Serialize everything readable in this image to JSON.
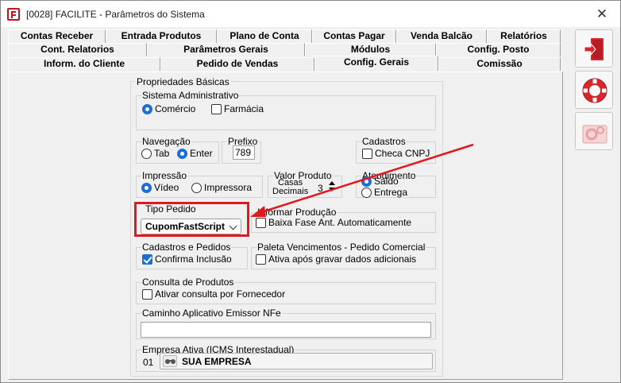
{
  "window": {
    "title": "[0028] FACILITE - Parâmetros do Sistema",
    "close_glyph": "✕"
  },
  "tabs": {
    "row1": [
      "Contas Receber",
      "Entrada Produtos",
      "Plano de Conta",
      "Contas Pagar",
      "Venda Balcão",
      "Relatórios"
    ],
    "row2": [
      "Cont. Relatorios",
      "Parâmetros Gerais",
      "Módulos",
      "Config. Posto"
    ],
    "row3": [
      "Inform. do Cliente",
      "Pedido de Vendas",
      "Config. Gerais",
      "Comissão"
    ],
    "active": "Config. Gerais"
  },
  "propriedades": {
    "title": "Propriedades Básicas",
    "sistema_admin": {
      "title": "Sistema Administrativo",
      "comercio": "Comércio",
      "comercio_selected": true,
      "farmacia": "Farmácia",
      "farmacia_checked": false
    },
    "navegacao": {
      "title": "Navegação",
      "tab": "Tab",
      "enter": "Enter",
      "selected": "Enter"
    },
    "prefixo": {
      "title": "Prefixo",
      "value": "789"
    },
    "cadastros": {
      "title": "Cadastros",
      "checa_cnpj": "Checa CNPJ",
      "checked": false
    },
    "impressao": {
      "title": "Impressão",
      "video": "Vídeo",
      "impressora": "Impressora",
      "selected": "Vídeo"
    },
    "valor_produto": {
      "title": "Valor Produto",
      "casas": "Casas",
      "decimais": "Decimais",
      "value": "3"
    },
    "atendimento": {
      "title": "Atendimento",
      "saldo": "Saldo",
      "entrega": "Entrega",
      "selected": "Saldo"
    },
    "tipo_pedido": {
      "title": "Tipo Pedido",
      "value": "CupomFastScript"
    },
    "informar_producao": {
      "title": "Informar Produção",
      "baixa_fase": "Baixa Fase Ant. Automaticamente",
      "checked": false
    },
    "cadastros_pedidos": {
      "title": "Cadastros e Pedidos",
      "confirma_inclusao": "Confirma Inclusão",
      "checked": true
    },
    "paleta": {
      "title": "Paleta Vencimentos - Pedido Comercial",
      "ativa": "Ativa após gravar dados adicionais",
      "checked": false
    },
    "consulta_produtos": {
      "title": "Consulta de Produtos",
      "ativar": "Ativar consulta por Fornecedor",
      "checked": false
    },
    "caminho_nfe": {
      "title": "Caminho Aplicativo Emissor NFe",
      "value": ""
    },
    "empresa_ativa": {
      "title": "Empresa Ativa (ICMS Interestadual)",
      "code": "01",
      "name": "SUA EMPRESA"
    }
  },
  "colors": {
    "accent": "#1c6fd1",
    "highlight": "#e0191f",
    "exit_icon": "#d6262e",
    "lifebuoy": "#d6262e",
    "settings_icon": "#e8a0a0"
  },
  "side_icons": [
    "exit-door-icon",
    "lifebuoy-icon",
    "settings-gears-icon"
  ]
}
